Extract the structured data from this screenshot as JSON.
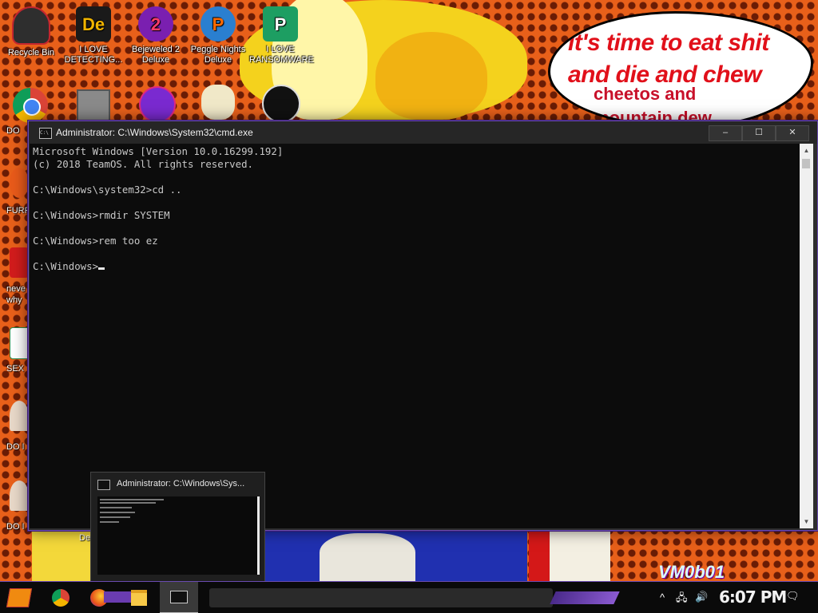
{
  "desktop": {
    "icons_top": [
      {
        "label": "Recycle Bin",
        "icon": "recycle-bin-icon",
        "color": "#3a3a3a"
      },
      {
        "label": "I LOVE DETECTING...",
        "icon": "detective-icon",
        "glyph": "De",
        "color": "#e8a400"
      },
      {
        "label": "Bejeweled 2 Deluxe",
        "icon": "bejeweled-icon",
        "glyph": "2",
        "color": "#d23a8a"
      },
      {
        "label": "Peggle Nights Deluxe",
        "icon": "peggle-icon",
        "glyph": "P",
        "color": "#2a7fd0"
      },
      {
        "label": "I LOVE RANSOMWARE",
        "icon": "ransomware-icon",
        "glyph": "P",
        "color": "#1d9e62"
      }
    ],
    "side_labels": [
      "DO",
      "FURF",
      "neve",
      "why",
      "SEX",
      "DO I",
      "DO I",
      "De"
    ],
    "speech_bubble": {
      "line1": "it's time to eat shit",
      "line2": "and die and chew",
      "line3": "cheetos and",
      "line4": "mountain dew"
    },
    "watermark": "VM0b01"
  },
  "cmd_window": {
    "title": "Administrator: C:\\Windows\\System32\\cmd.exe",
    "controls": {
      "minimize": "–",
      "maximize": "☐",
      "close": "✕"
    },
    "lines": [
      "Microsoft Windows [Version 10.0.16299.192]",
      "(c) 2018 TeamOS. All rights reserved.",
      "",
      "C:\\Windows\\system32>cd ..",
      "",
      "C:\\Windows>rmdir SYSTEM",
      "",
      "C:\\Windows>rem too ez",
      "",
      "C:\\Windows>"
    ]
  },
  "preview": {
    "title": "Administrator: C:\\Windows\\Sys..."
  },
  "taskbar": {
    "clock": "6:07 PM",
    "apps": [
      {
        "name": "chrome",
        "icon": "chrome-icon"
      },
      {
        "name": "firefox",
        "icon": "firefox-icon"
      },
      {
        "name": "file-explorer",
        "icon": "folder-icon"
      },
      {
        "name": "cmd",
        "icon": "cmd-icon"
      }
    ]
  }
}
